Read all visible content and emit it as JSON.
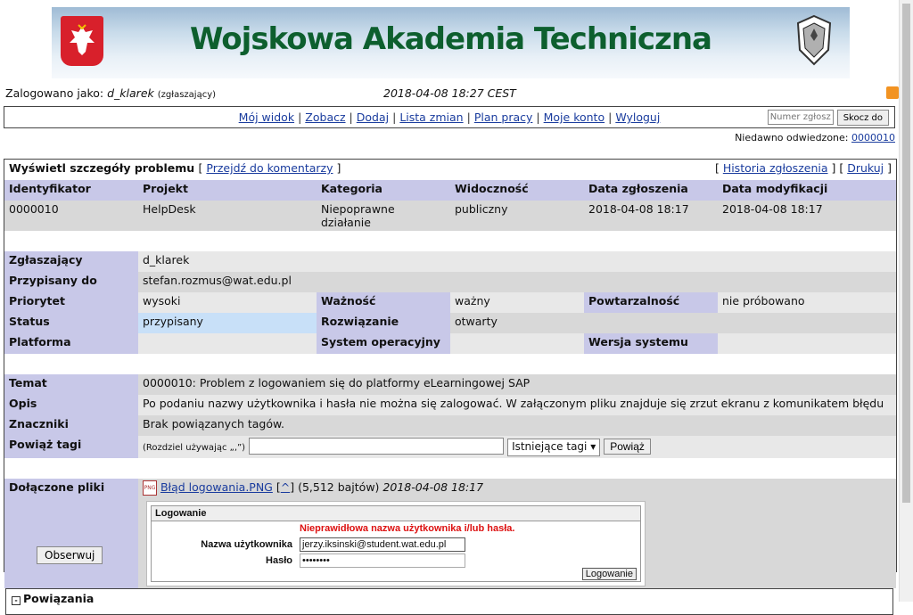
{
  "banner": {
    "title": "Wojskowa Akademia Techniczna",
    "logo_right_text": "WAT"
  },
  "login": {
    "prefix": "Zalogowano jako:",
    "user": "d_klarek",
    "role": "(zgłaszający)",
    "datetime": "2018-04-08 18:27 CEST"
  },
  "menu": {
    "items": [
      "Mój widok",
      "Zobacz",
      "Dodaj",
      "Lista zmian",
      "Plan pracy",
      "Moje konto",
      "Wyloguj"
    ],
    "jump_placeholder": "Numer zgłoszenia",
    "jump_button": "Skocz do"
  },
  "recent": {
    "label": "Niedawno odwiedzone:",
    "link": "0000010"
  },
  "issue": {
    "heading": "Wyświetl szczegóły problemu",
    "goto_comments": "Przejdź do komentarzy",
    "history": "Historia zgłoszenia",
    "print": "Drukuj",
    "columns": [
      "Identyfikator",
      "Projekt",
      "Kategoria",
      "Widoczność",
      "Data zgłoszenia",
      "Data modyfikacji"
    ],
    "values": [
      "0000010",
      "HelpDesk",
      "Niepoprawne działanie",
      "publiczny",
      "2018-04-08 18:17",
      "2018-04-08 18:17"
    ],
    "reporter_label": "Zgłaszający",
    "reporter": "d_klarek",
    "assigned_label": "Przypisany do",
    "assigned": "stefan.rozmus@wat.edu.pl",
    "priority_label": "Priorytet",
    "priority": "wysoki",
    "severity_label": "Ważność",
    "severity": "ważny",
    "repro_label": "Powtarzalność",
    "repro": "nie próbowano",
    "status_label": "Status",
    "status": "przypisany",
    "resolution_label": "Rozwiązanie",
    "resolution": "otwarty",
    "platform_label": "Platforma",
    "os_label": "System operacyjny",
    "os_version_label": "Wersja systemu",
    "subject_label": "Temat",
    "subject": "0000010: Problem z logowaniem się do platformy eLearningowej SAP",
    "desc_label": "Opis",
    "desc": "Po podaniu nazwy użytkownika i hasła nie można się zalogować. W załączonym pliku znajduje się zrzut ekranu z komunikatem błędu",
    "tags_label": "Znaczniki",
    "tags": "Brak powiązanych tagów.",
    "link_tags_label": "Powiąż tagi",
    "link_tags_hint": "(Rozdziel używając „,”)",
    "existing_tags": "Istniejące tagi",
    "link_button": "Powiąż",
    "files_label": "Dołączone pliki",
    "file_name": "Błąd logowania.PNG",
    "file_up": "^",
    "file_size": "(5,512 bajtów)",
    "file_date": "2018-04-08 18:17"
  },
  "screenshot": {
    "title": "Logowanie",
    "error": "Nieprawidłowa nazwa użytkownika i/lub hasła.",
    "user_label": "Nazwa użytkownika",
    "user_value": "jerzy.iksinski@student.wat.edu.pl",
    "pass_label": "Hasło",
    "pass_value": "••••••••",
    "button": "Logowanie"
  },
  "observe_button": "Obserwuj",
  "relations_label": "Powiązania"
}
